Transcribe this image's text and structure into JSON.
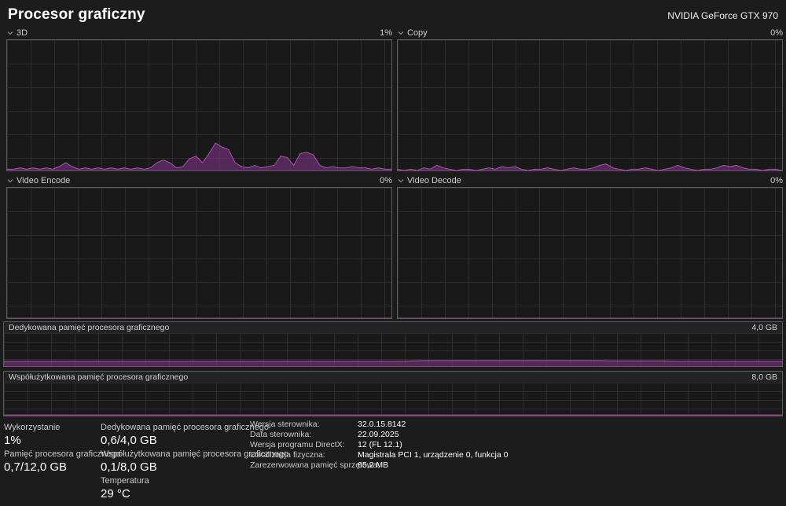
{
  "header": {
    "title": "Procesor graficzny",
    "gpu_name": "NVIDIA GeForce GTX 970"
  },
  "colors": {
    "accent": "#b34db8",
    "chart_line": "#b34db8",
    "chart_fill": "rgba(134,53,143,0.55)",
    "grid_line": "#2d2d2d",
    "chart_bg": "#191919"
  },
  "charts": [
    {
      "label": "3D",
      "value": "1%"
    },
    {
      "label": "Copy",
      "value": "0%"
    },
    {
      "label": "Video Encode",
      "value": "0%"
    },
    {
      "label": "Video Decode",
      "value": "0%"
    }
  ],
  "memory_charts": [
    {
      "label": "Dedykowana pamięć procesora graficznego",
      "capacity": "4,0 GB"
    },
    {
      "label": "Współużytkowana pamięć procesora graficznego",
      "capacity": "8,0 GB"
    }
  ],
  "stats": {
    "utilization": {
      "label": "Wykorzystanie",
      "value": "1%"
    },
    "gpu_memory": {
      "label": "Pamięć procesora graficznego",
      "value": "0,7/12,0 GB"
    },
    "dedicated_memory": {
      "label": "Dedykowana pamięć procesora graficznego",
      "value": "0,6/4,0 GB"
    },
    "shared_memory": {
      "label": "Współużytkowana pamięć procesora graficznego",
      "value": "0,1/8,0 GB"
    },
    "temperature": {
      "label": "Temperatura",
      "value": "29 °C"
    }
  },
  "details": [
    {
      "label": "Wersja sterownika:",
      "value": "32.0.15.8142"
    },
    {
      "label": "Data sterownika:",
      "value": "22.09.2025"
    },
    {
      "label": "Wersja programu DirectX:",
      "value": "12 (FL 12.1)"
    },
    {
      "label": "Lokalizacja fizyczna:",
      "value": "Magistrala PCI 1, urządzenie 0, funkcja 0"
    },
    {
      "label": "Zarezerwowana pamięć sprzętowa:",
      "value": "65,2 MB"
    }
  ],
  "chart_data": [
    {
      "type": "area",
      "title": "3D",
      "unit": "%",
      "ylim": [
        0,
        100
      ],
      "values": [
        1,
        1,
        2,
        1,
        2,
        1,
        2,
        1,
        3,
        6,
        3,
        1,
        2,
        1,
        2,
        1,
        2,
        1,
        2,
        1,
        2,
        1,
        2,
        6,
        8,
        6,
        2,
        3,
        9,
        11,
        6,
        13,
        21,
        18,
        16,
        6,
        3,
        2,
        4,
        2,
        3,
        4,
        11,
        10,
        4,
        13,
        14,
        12,
        4,
        2,
        3,
        2,
        2,
        3,
        2,
        2,
        1,
        2,
        1,
        1
      ]
    },
    {
      "type": "area",
      "title": "Copy",
      "unit": "%",
      "ylim": [
        0,
        100
      ],
      "values": [
        1,
        0,
        1,
        0,
        2,
        1,
        4,
        2,
        1,
        0,
        1,
        1,
        0,
        1,
        2,
        1,
        3,
        2,
        3,
        1,
        0,
        1,
        1,
        2,
        1,
        0,
        1,
        2,
        1,
        1,
        2,
        4,
        5,
        2,
        1,
        0,
        1,
        1,
        2,
        1,
        0,
        1,
        2,
        4,
        2,
        1,
        0,
        1,
        1,
        2,
        4,
        3,
        4,
        2,
        1,
        1,
        0,
        1,
        1,
        0
      ]
    },
    {
      "type": "area",
      "title": "Video Encode",
      "unit": "%",
      "ylim": [
        0,
        100
      ],
      "values": [
        0,
        0
      ]
    },
    {
      "type": "area",
      "title": "Video Decode",
      "unit": "%",
      "ylim": [
        0,
        100
      ],
      "values": [
        0,
        0
      ]
    },
    {
      "type": "area",
      "title": "Dedykowana pamięć procesora graficznego",
      "unit": "% of 4,0 GB",
      "ylim": [
        0,
        100
      ],
      "values": [
        15,
        15,
        15,
        15,
        15,
        15,
        15,
        15,
        15,
        15,
        15,
        15,
        15,
        15,
        15,
        15,
        15,
        15,
        15,
        15,
        15,
        15,
        15,
        15,
        15,
        15,
        15,
        15,
        15,
        15,
        15,
        16,
        17,
        17,
        17,
        17,
        17,
        17,
        17,
        17,
        17,
        17,
        17,
        17,
        17,
        17,
        16,
        16,
        16,
        16,
        16,
        15,
        15,
        15,
        15,
        15,
        15,
        15,
        15,
        15
      ]
    },
    {
      "type": "area",
      "title": "Współużytkowana pamięć procesora graficznego",
      "unit": "% of 8,0 GB",
      "ylim": [
        0,
        100
      ],
      "values": [
        2,
        2
      ]
    }
  ]
}
